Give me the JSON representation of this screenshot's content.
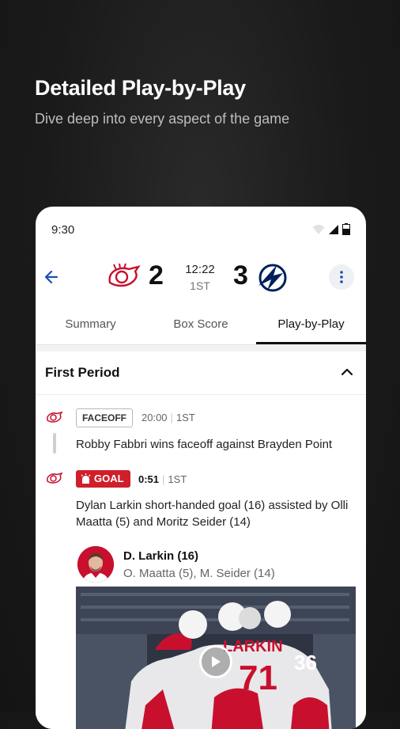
{
  "promo": {
    "title": "Detailed Play-by-Play",
    "subtitle": "Dive deep into every aspect of the game"
  },
  "status_bar": {
    "time": "9:30",
    "icons": [
      "wifi-icon",
      "signal-icon",
      "battery-icon"
    ]
  },
  "game": {
    "home_team_logo": "red-wings-logo-icon",
    "away_team_logo": "lightning-logo-icon",
    "home_score": "2",
    "away_score": "3",
    "clock": "12:22",
    "period": "1ST"
  },
  "tabs": [
    {
      "label": "Summary",
      "active": false
    },
    {
      "label": "Box Score",
      "active": false
    },
    {
      "label": "Play-by-Play",
      "active": true
    }
  ],
  "plays": {
    "section_title": "First Period",
    "events": [
      {
        "type_label": "FACEOFF",
        "time": "20:00",
        "period": "1ST",
        "description": "Robby Fabbri wins faceoff against Brayden Point"
      },
      {
        "type_label": "GOAL",
        "time": "0:51",
        "period": "1ST",
        "description": "Dylan Larkin short-handed goal (16) assisted by Olli Maatta (5) and Moritz Seider (14)",
        "scorer": "D. Larkin (16)",
        "assists": "O. Maatta (5), M. Seider (14)"
      }
    ]
  },
  "colors": {
    "accent_blue": "#1a4fb8",
    "goal_red": "#cf1f2b",
    "red_wings_red": "#c8102e",
    "lightning_blue": "#00205b"
  }
}
